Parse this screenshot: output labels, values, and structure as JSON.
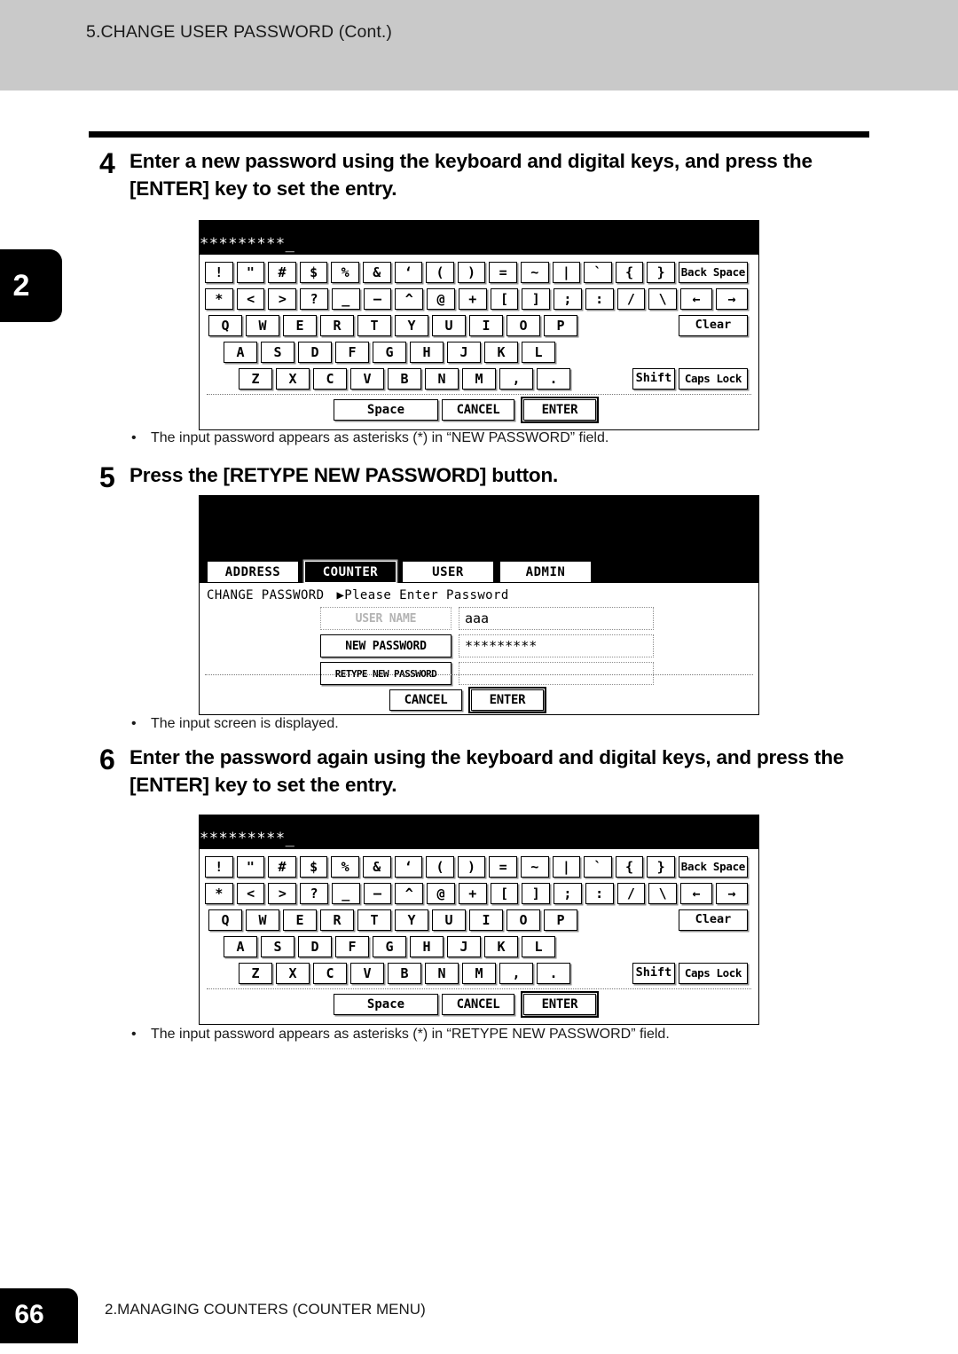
{
  "header": {
    "title": "5.CHANGE USER PASSWORD (Cont.)"
  },
  "chapter_tab": {
    "number": "2"
  },
  "steps": [
    {
      "number": "4",
      "text": "Enter a new password using the keyboard and digital keys, and press the [ENTER] key to set the entry."
    },
    {
      "number": "5",
      "text": "Press the [RETYPE NEW PASSWORD] button."
    },
    {
      "number": "6",
      "text": "Enter the password again using the keyboard and digital keys, and press the [ENTER] key to set the entry."
    }
  ],
  "notes": [
    {
      "bullet": "•",
      "text": "The input password appears as asterisks (*) in “NEW PASSWORD” field."
    },
    {
      "bullet": "•",
      "text": "The input screen is displayed."
    },
    {
      "bullet": "•",
      "text": "The input password appears as asterisks (*) in “RETYPE NEW PASSWORD” field."
    }
  ],
  "keyboard_screen": {
    "display_value": "*********_",
    "rows": {
      "symbols1": [
        "!",
        "\"",
        "#",
        "$",
        "%",
        "&",
        "‘",
        "(",
        ")",
        "=",
        "~",
        "|",
        "`",
        "{",
        "}"
      ],
      "symbols2": [
        "*",
        "<",
        ">",
        "?",
        "_",
        "—",
        "^",
        "@",
        "+",
        "[",
        "]",
        ";",
        ":",
        "/",
        "\\"
      ],
      "alpha1": [
        "Q",
        "W",
        "E",
        "R",
        "T",
        "Y",
        "U",
        "I",
        "O",
        "P"
      ],
      "alpha2": [
        "A",
        "S",
        "D",
        "F",
        "G",
        "H",
        "J",
        "K",
        "L"
      ],
      "alpha3": [
        "Z",
        "X",
        "C",
        "V",
        "B",
        "N",
        "M",
        ",",
        "."
      ]
    },
    "back_space_label": "Back Space",
    "arrow_left_label": "←",
    "arrow_right_label": "→",
    "clear_label": "Clear",
    "shift_label": "Shift",
    "caps_lock_label": "Caps Lock",
    "space_label": "Space",
    "cancel_label": "CANCEL",
    "enter_label": "ENTER"
  },
  "settings_screen": {
    "tabs": [
      {
        "label": "ADDRESS",
        "selected": false
      },
      {
        "label": "COUNTER",
        "selected": true
      },
      {
        "label": "USER",
        "selected": false
      },
      {
        "label": "ADMIN",
        "selected": false
      }
    ],
    "breadcrumb_title": "CHANGE PASSWORD",
    "breadcrumb_arrow": "▶Please Enter Password",
    "fields": [
      {
        "label": "USER NAME",
        "value": "aaa",
        "dim": true
      },
      {
        "label": "NEW PASSWORD",
        "value": "*********",
        "dim": false
      },
      {
        "label": "RETYPE NEW PASSWORD",
        "value": "",
        "dim": false
      }
    ],
    "cancel_label": "CANCEL",
    "enter_label": "ENTER"
  },
  "footer": {
    "page_number": "66",
    "section": "2.MANAGING COUNTERS (COUNTER MENU)"
  }
}
